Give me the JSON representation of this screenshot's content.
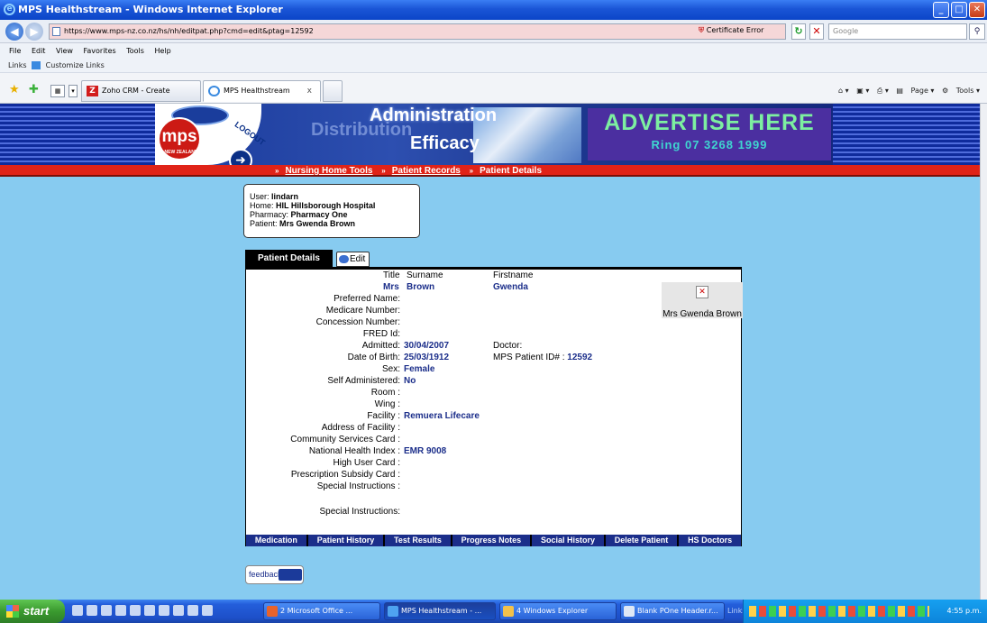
{
  "window": {
    "title": "MPS Healthstream - Windows Internet Explorer"
  },
  "addressbar": {
    "url": "https://www.mps-nz.co.nz/hs/nh/editpat.php?cmd=edit&ptag=12592",
    "cert_error": "Certificate Error",
    "search_placeholder": "Google"
  },
  "menu": [
    "File",
    "Edit",
    "View",
    "Favorites",
    "Tools",
    "Help"
  ],
  "links_bar": "Links",
  "links_item": "Customize Links",
  "tabs": [
    {
      "label": "Zoho CRM - Create Contact"
    },
    {
      "label": "MPS Healthstream"
    }
  ],
  "tab_close": "x",
  "commandbar": {
    "page": "Page",
    "tools": "Tools"
  },
  "banner": {
    "logo": "mps",
    "logo_sub": "NEW ZEALAND",
    "logout": "LOGOUT",
    "admin": "Administration",
    "distribution": "Distribution",
    "efficacy": "Efficacy",
    "ad_title": "ADVERTISE HERE",
    "ad_phone": "Ring 07 3268 1999"
  },
  "breadcrumbs": [
    "Nursing Home Tools",
    "Patient Records",
    "Patient Details"
  ],
  "userinfo": {
    "user_label": "User:",
    "user": "lindarn",
    "home_label": "Home:",
    "home": "HIL Hillsborough Hospital",
    "pharmacy_label": "Pharmacy:",
    "pharmacy": "Pharmacy One",
    "patient_label": "Patient:",
    "patient": "Mrs Gwenda Brown"
  },
  "panel": {
    "tab_label": "Patient Details",
    "edit_label": "Edit",
    "header_title": "Title",
    "header_surname": "Surname",
    "header_firstname": "Firstname",
    "title": "Mrs",
    "surname": "Brown",
    "firstname": "Gwenda",
    "doctor_label": "Doctor:",
    "doctor_value": "",
    "mps_id_label": "MPS Patient ID# :",
    "mps_id": "12592",
    "photo_caption": "Mrs Gwenda Brown",
    "fields": [
      {
        "label": "Preferred Name:",
        "value": ""
      },
      {
        "label": "Medicare Number:",
        "value": ""
      },
      {
        "label": "Concession Number:",
        "value": ""
      },
      {
        "label": "FRED Id:",
        "value": ""
      },
      {
        "label": "Admitted:",
        "value": "30/04/2007"
      },
      {
        "label": "Date of Birth:",
        "value": "25/03/1912"
      },
      {
        "label": "Sex:",
        "value": "Female"
      },
      {
        "label": "Self Administered:",
        "value": "No"
      },
      {
        "label": "Room :",
        "value": ""
      },
      {
        "label": "Wing :",
        "value": ""
      },
      {
        "label": "Facility :",
        "value": "Remuera Lifecare"
      },
      {
        "label": "Address of Facility :",
        "value": ""
      },
      {
        "label": "Community Services Card :",
        "value": ""
      },
      {
        "label": "National Health Index :",
        "value": "EMR 9008"
      },
      {
        "label": "High User Card :",
        "value": ""
      },
      {
        "label": "Prescription Subsidy Card :",
        "value": ""
      },
      {
        "label": "Special Instructions :",
        "value": ""
      },
      {
        "label": "Special Instructions:",
        "value": ""
      }
    ]
  },
  "buttons": [
    "Medication",
    "Patient History",
    "Test Results",
    "Progress Notes",
    "Social History",
    "Delete Patient",
    "HS Doctors"
  ],
  "feedback": "feedback",
  "taskbar": {
    "start": "start",
    "items": [
      "2 Microsoft Office ...",
      "MPS Healthstream - ...",
      "4 Windows Explorer",
      "Blank POne Header.r..."
    ],
    "links": "Links",
    "clock": "4:55 p.m."
  }
}
